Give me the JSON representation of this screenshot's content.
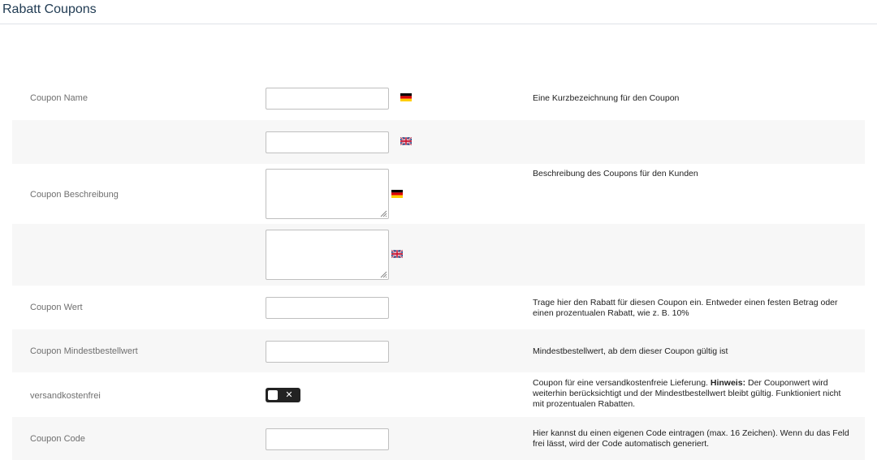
{
  "page": {
    "title": "Rabatt Coupons"
  },
  "form": {
    "coupon_name": {
      "label": "Coupon Name",
      "value_de": "",
      "value_en": "",
      "help": "Eine Kurzbezeichnung für den Coupon",
      "flag_de_icon": "flag-germany-icon",
      "flag_en_icon": "flag-uk-icon"
    },
    "coupon_description": {
      "label": "Coupon Beschreibung",
      "value_de": "",
      "value_en": "",
      "help": "Beschreibung des Coupons für den Kunden"
    },
    "coupon_value": {
      "label": "Coupon Wert",
      "value": "",
      "help": "Trage hier den Rabatt für diesen Coupon ein. Entweder einen festen Betrag oder einen prozentualen Rabatt, wie z. B. 10%"
    },
    "min_order": {
      "label": "Coupon Mindestbestellwert",
      "value": "",
      "help": "Mindestbestellwert, ab dem dieser Coupon gültig ist"
    },
    "free_shipping": {
      "label": "versandkostenfrei",
      "state": "off",
      "toggle_symbol": "✕",
      "help_prefix": "Coupon für eine versandkostenfreie Lieferung. ",
      "help_bold": "Hinweis:",
      "help_suffix": " Der Couponwert wird weiterhin berücksichtigt und der Mindestbestellwert bleibt gültig. Funktioniert nicht mit prozentualen Rabatten."
    },
    "coupon_code": {
      "label": "Coupon Code",
      "value": "",
      "help": "Hier kannst du einen eigenen Code eintragen (max. 16 Zeichen). Wenn du das Feld frei lässt, wird der Code automatisch generiert."
    }
  },
  "colors": {
    "row_alt_bg": "#f7f7f7",
    "title": "#1f3a52",
    "toggle_bg": "#222222"
  }
}
